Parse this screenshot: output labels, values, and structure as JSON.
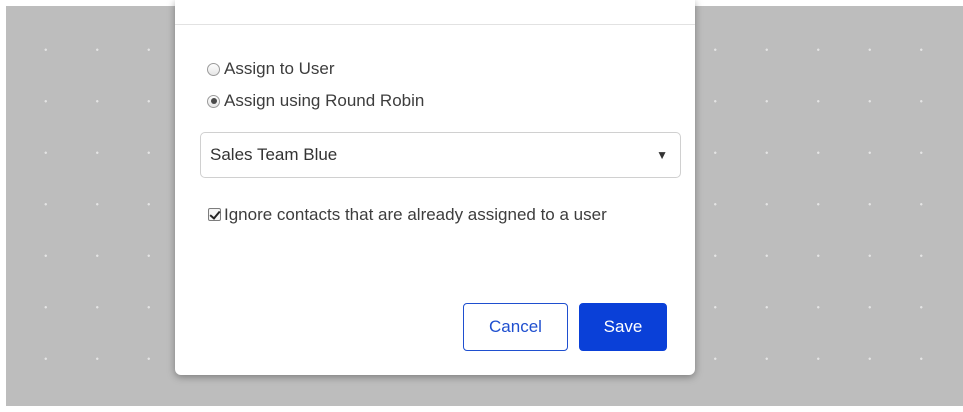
{
  "assignment": {
    "options": [
      {
        "label": "Assign to User",
        "checked": false
      },
      {
        "label": "Assign using Round Robin",
        "checked": true
      }
    ],
    "team_select": {
      "value": "Sales Team Blue",
      "arrow": "▼"
    },
    "ignore_assigned": {
      "label": "Ignore contacts that are already assigned to a user",
      "checked": true
    }
  },
  "actions": {
    "cancel_label": "Cancel",
    "save_label": "Save"
  },
  "colors": {
    "primary": "#0a40d8",
    "cancel_border": "#1f4fcf",
    "backdrop": "#bdbdbd"
  },
  "icons": {
    "select_arrow": "chevron-down-icon"
  }
}
